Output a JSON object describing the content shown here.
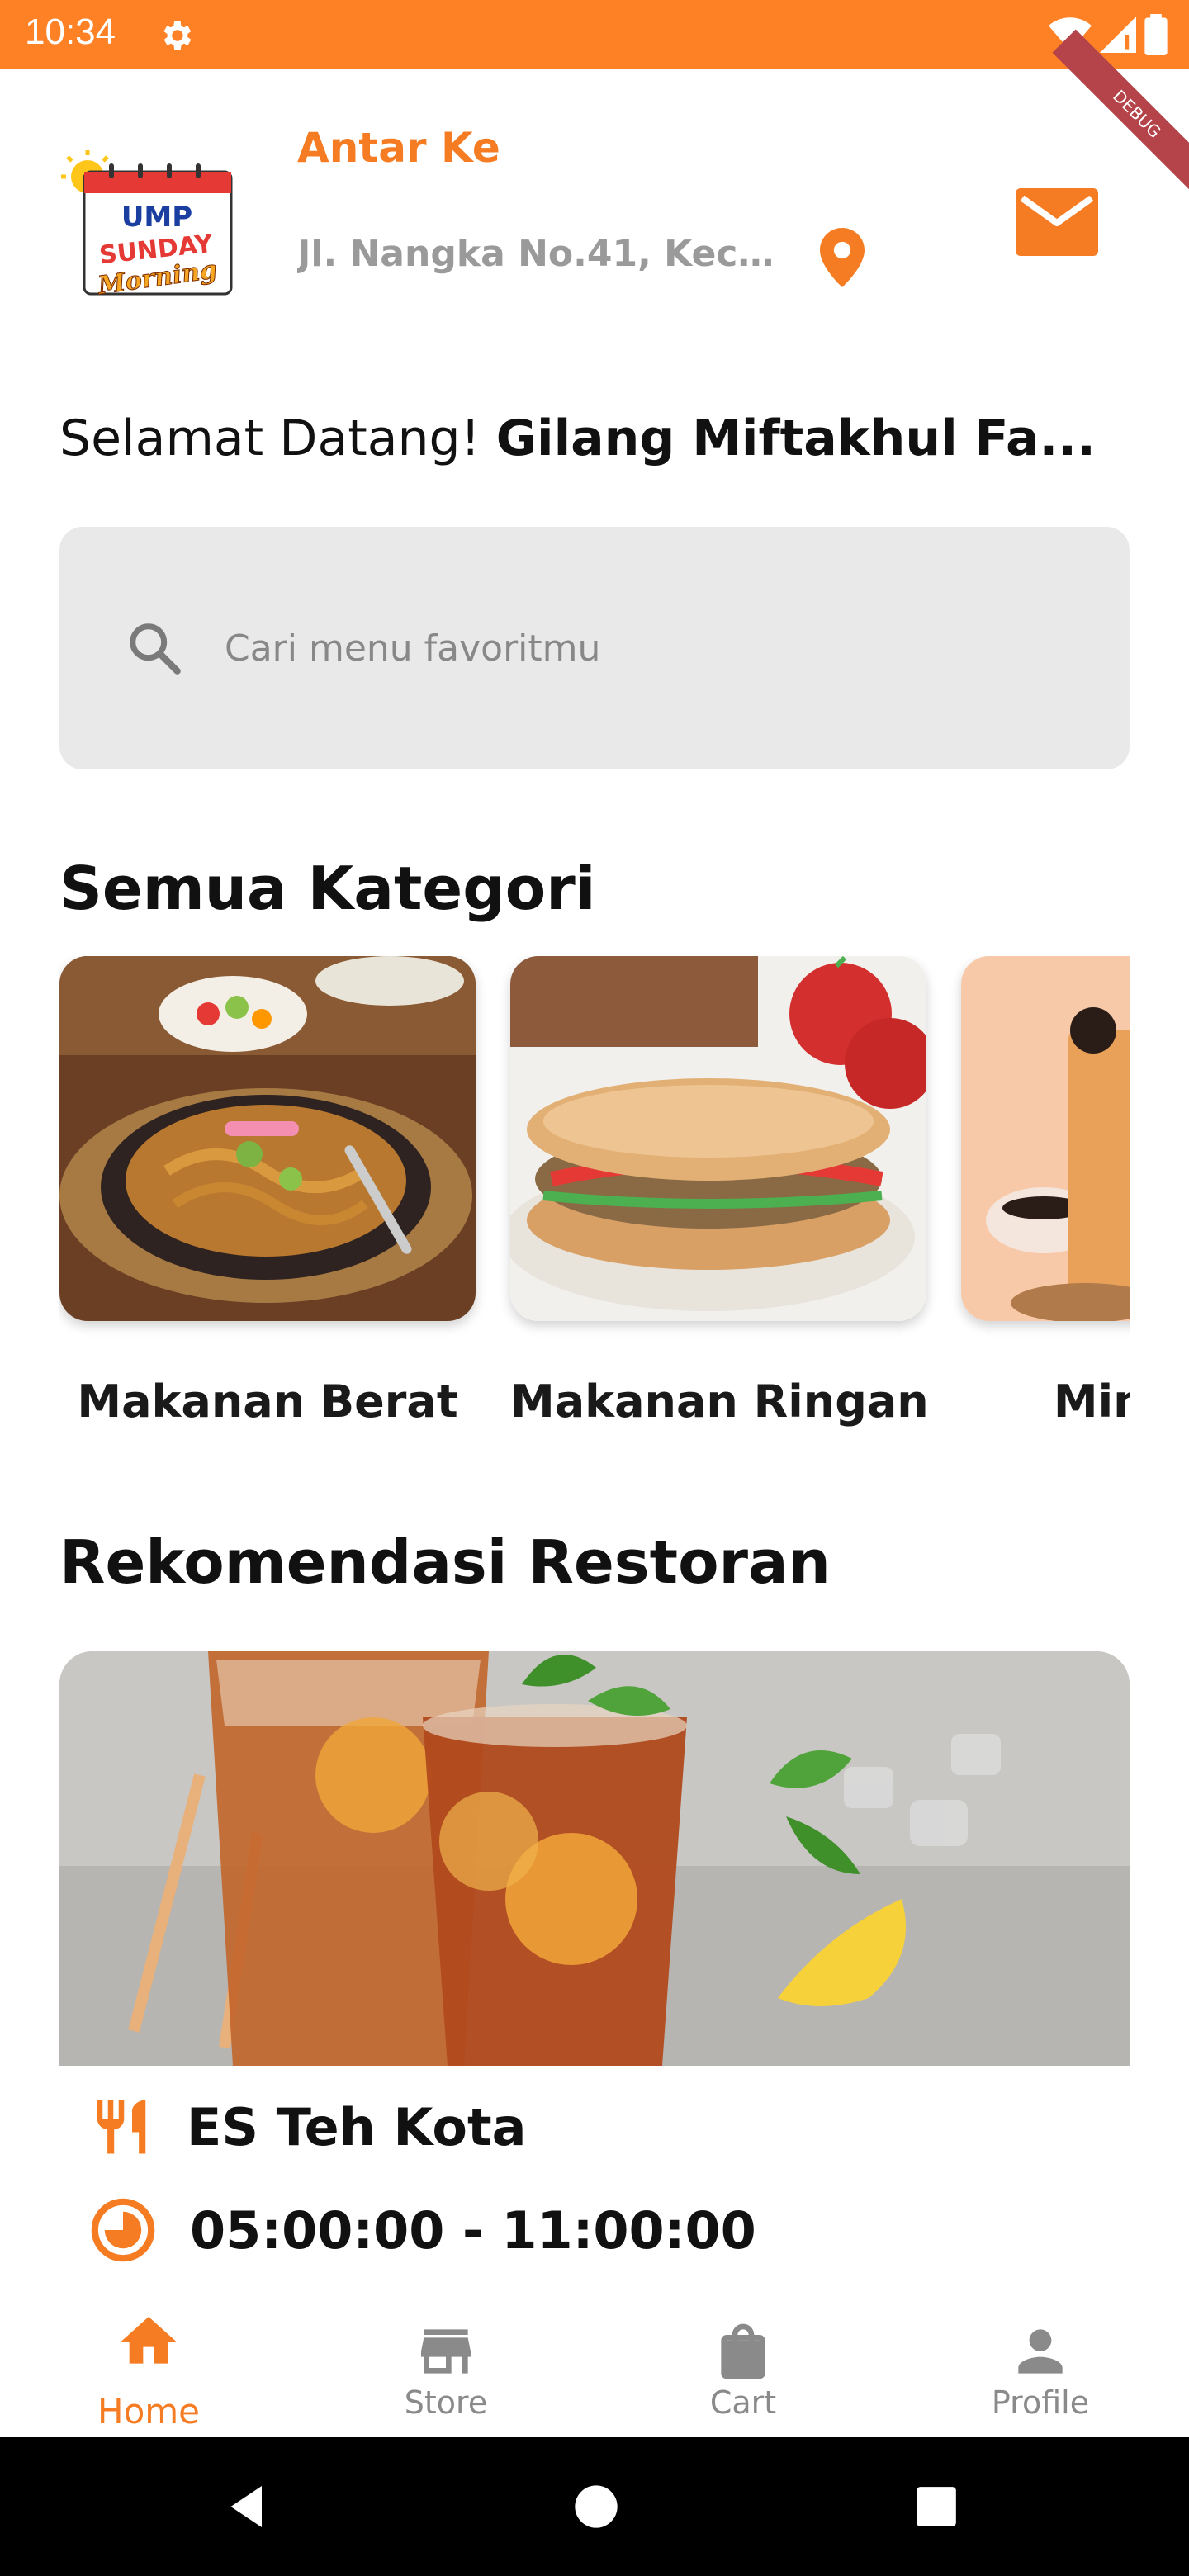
{
  "status_bar": {
    "time": "10:34",
    "icons": [
      "gear-icon",
      "wifi-icon",
      "signal-icon",
      "battery-icon"
    ]
  },
  "debug_banner": "DEBUG",
  "header": {
    "logo_text": [
      "UMP",
      "SUNDAY",
      "Morning"
    ],
    "deliver_label": "Antar Ke",
    "address": "Jl. Nangka No.41, Keca...",
    "icons": [
      "location-pin-icon",
      "mail-icon"
    ]
  },
  "welcome": {
    "greeting": "Selamat Datang!",
    "name": "Gilang Miftakhul Fa..."
  },
  "search": {
    "placeholder": "Cari menu favoritmu"
  },
  "categories": {
    "title": "Semua Kategori",
    "items": [
      {
        "label": "Makanan Berat"
      },
      {
        "label": "Makanan Ringan"
      },
      {
        "label": "Minuman"
      }
    ]
  },
  "recommendations": {
    "title": "Rekomendasi Restoran",
    "items": [
      {
        "name": "ES Teh Kota",
        "hours": "05:00:00 - 11:00:00"
      }
    ]
  },
  "bottom_nav": {
    "items": [
      {
        "label": "Home",
        "icon": "home-icon",
        "active": true
      },
      {
        "label": "Store",
        "icon": "store-icon",
        "active": false
      },
      {
        "label": "Cart",
        "icon": "shopping-bag-icon",
        "active": false
      },
      {
        "label": "Profile",
        "icon": "person-icon",
        "active": false
      }
    ]
  },
  "colors": {
    "accent": "#F57C22",
    "status_bar": "#FF8125",
    "inactive": "#8a8a8a"
  }
}
